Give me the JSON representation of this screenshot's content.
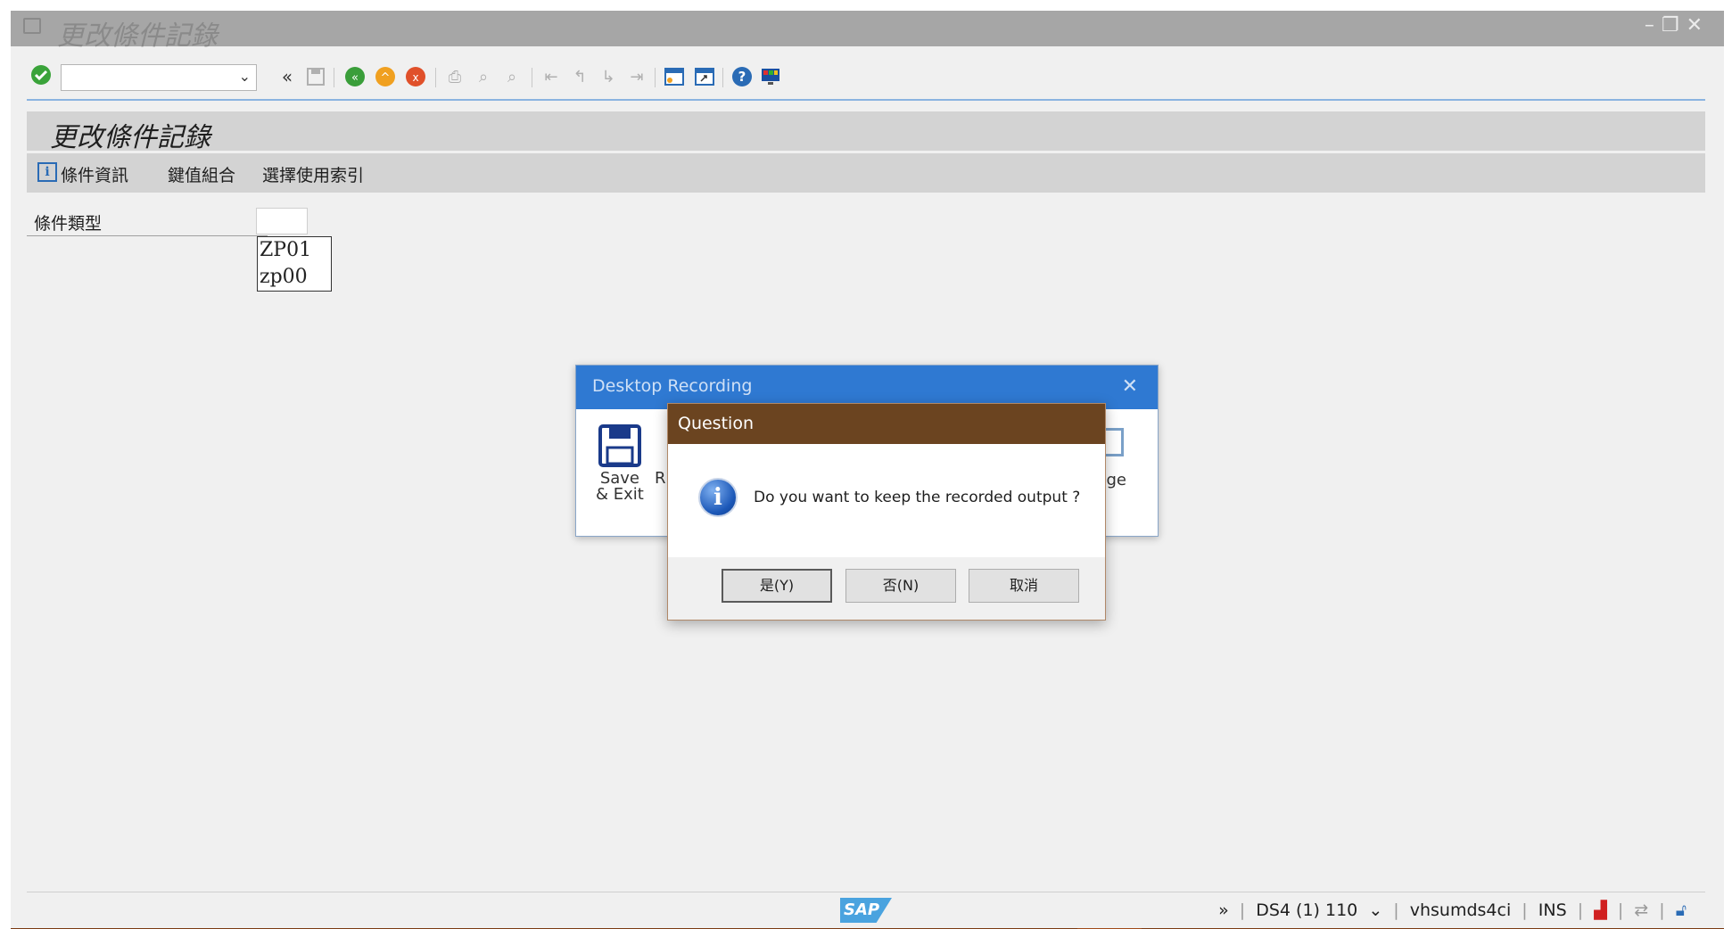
{
  "window": {
    "title": "更改條件記錄"
  },
  "toolbar": {
    "icons": [
      "enter-icon",
      "back-icon",
      "exit-icon",
      "cancel-icon",
      "print-icon",
      "find-icon",
      "find-next-icon",
      "first-page-icon",
      "prev-page-icon",
      "next-page-icon",
      "last-page-icon",
      "new-session-icon",
      "shortcut-icon",
      "help-icon",
      "customize-icon"
    ]
  },
  "header": {
    "title": "更改條件記錄"
  },
  "appbar": {
    "condition_info": "條件資訊",
    "key_combination": "鍵值組合",
    "choose_access": "選擇使用索引"
  },
  "field": {
    "label": "條件類型",
    "value": "",
    "options": [
      "ZP01",
      "zp00"
    ]
  },
  "desktop_recording": {
    "title": "Desktop Recording",
    "save_line1": "Save",
    "save_line2": "& Exit",
    "partial_left": "R",
    "partial_right": "ge"
  },
  "question": {
    "title": "Question",
    "message": "Do you want to keep the recorded output ?",
    "yes": "是(Y)",
    "no": "否(N)",
    "cancel": "取消"
  },
  "status": {
    "system": "DS4 (1) 110",
    "server": "vhsumds4ci",
    "mode": "INS"
  },
  "sap_logo_text": "SAP",
  "colors": {
    "title_bar": "#a6a6a6",
    "dialog_title": "#6b4420",
    "recording_title": "#2f79d2",
    "taskbar": "#7a3a12"
  }
}
